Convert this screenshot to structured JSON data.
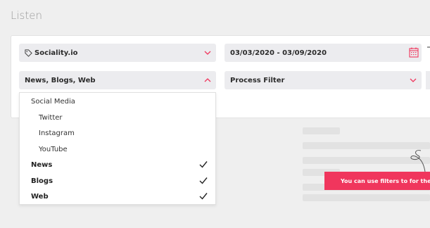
{
  "page": {
    "title": "Listen"
  },
  "filters": {
    "brand": {
      "value": "Sociality.io",
      "icon": "tag-icon"
    },
    "date_range": {
      "value": "03/03/2020 - 03/09/2020",
      "icon": "calendar-icon"
    },
    "sources": {
      "value": "News, Blogs, Web",
      "expanded": true
    },
    "process": {
      "value": "Process Filter"
    }
  },
  "sources_dropdown": {
    "items": [
      {
        "label": "Social Media",
        "level": "parent",
        "checked": false
      },
      {
        "label": "Twitter",
        "level": "child",
        "checked": false
      },
      {
        "label": "Instagram",
        "level": "child",
        "checked": false
      },
      {
        "label": "YouTube",
        "level": "child",
        "checked": false
      },
      {
        "label": "News",
        "level": "parent",
        "checked": true
      },
      {
        "label": "Blogs",
        "level": "parent",
        "checked": true
      },
      {
        "label": "Web",
        "level": "parent",
        "checked": true
      }
    ]
  },
  "hint": {
    "text": "You can use filters to for the m"
  },
  "colors": {
    "accent": "#f0365d",
    "field_bg": "#ececef",
    "page_bg": "#efefef"
  }
}
